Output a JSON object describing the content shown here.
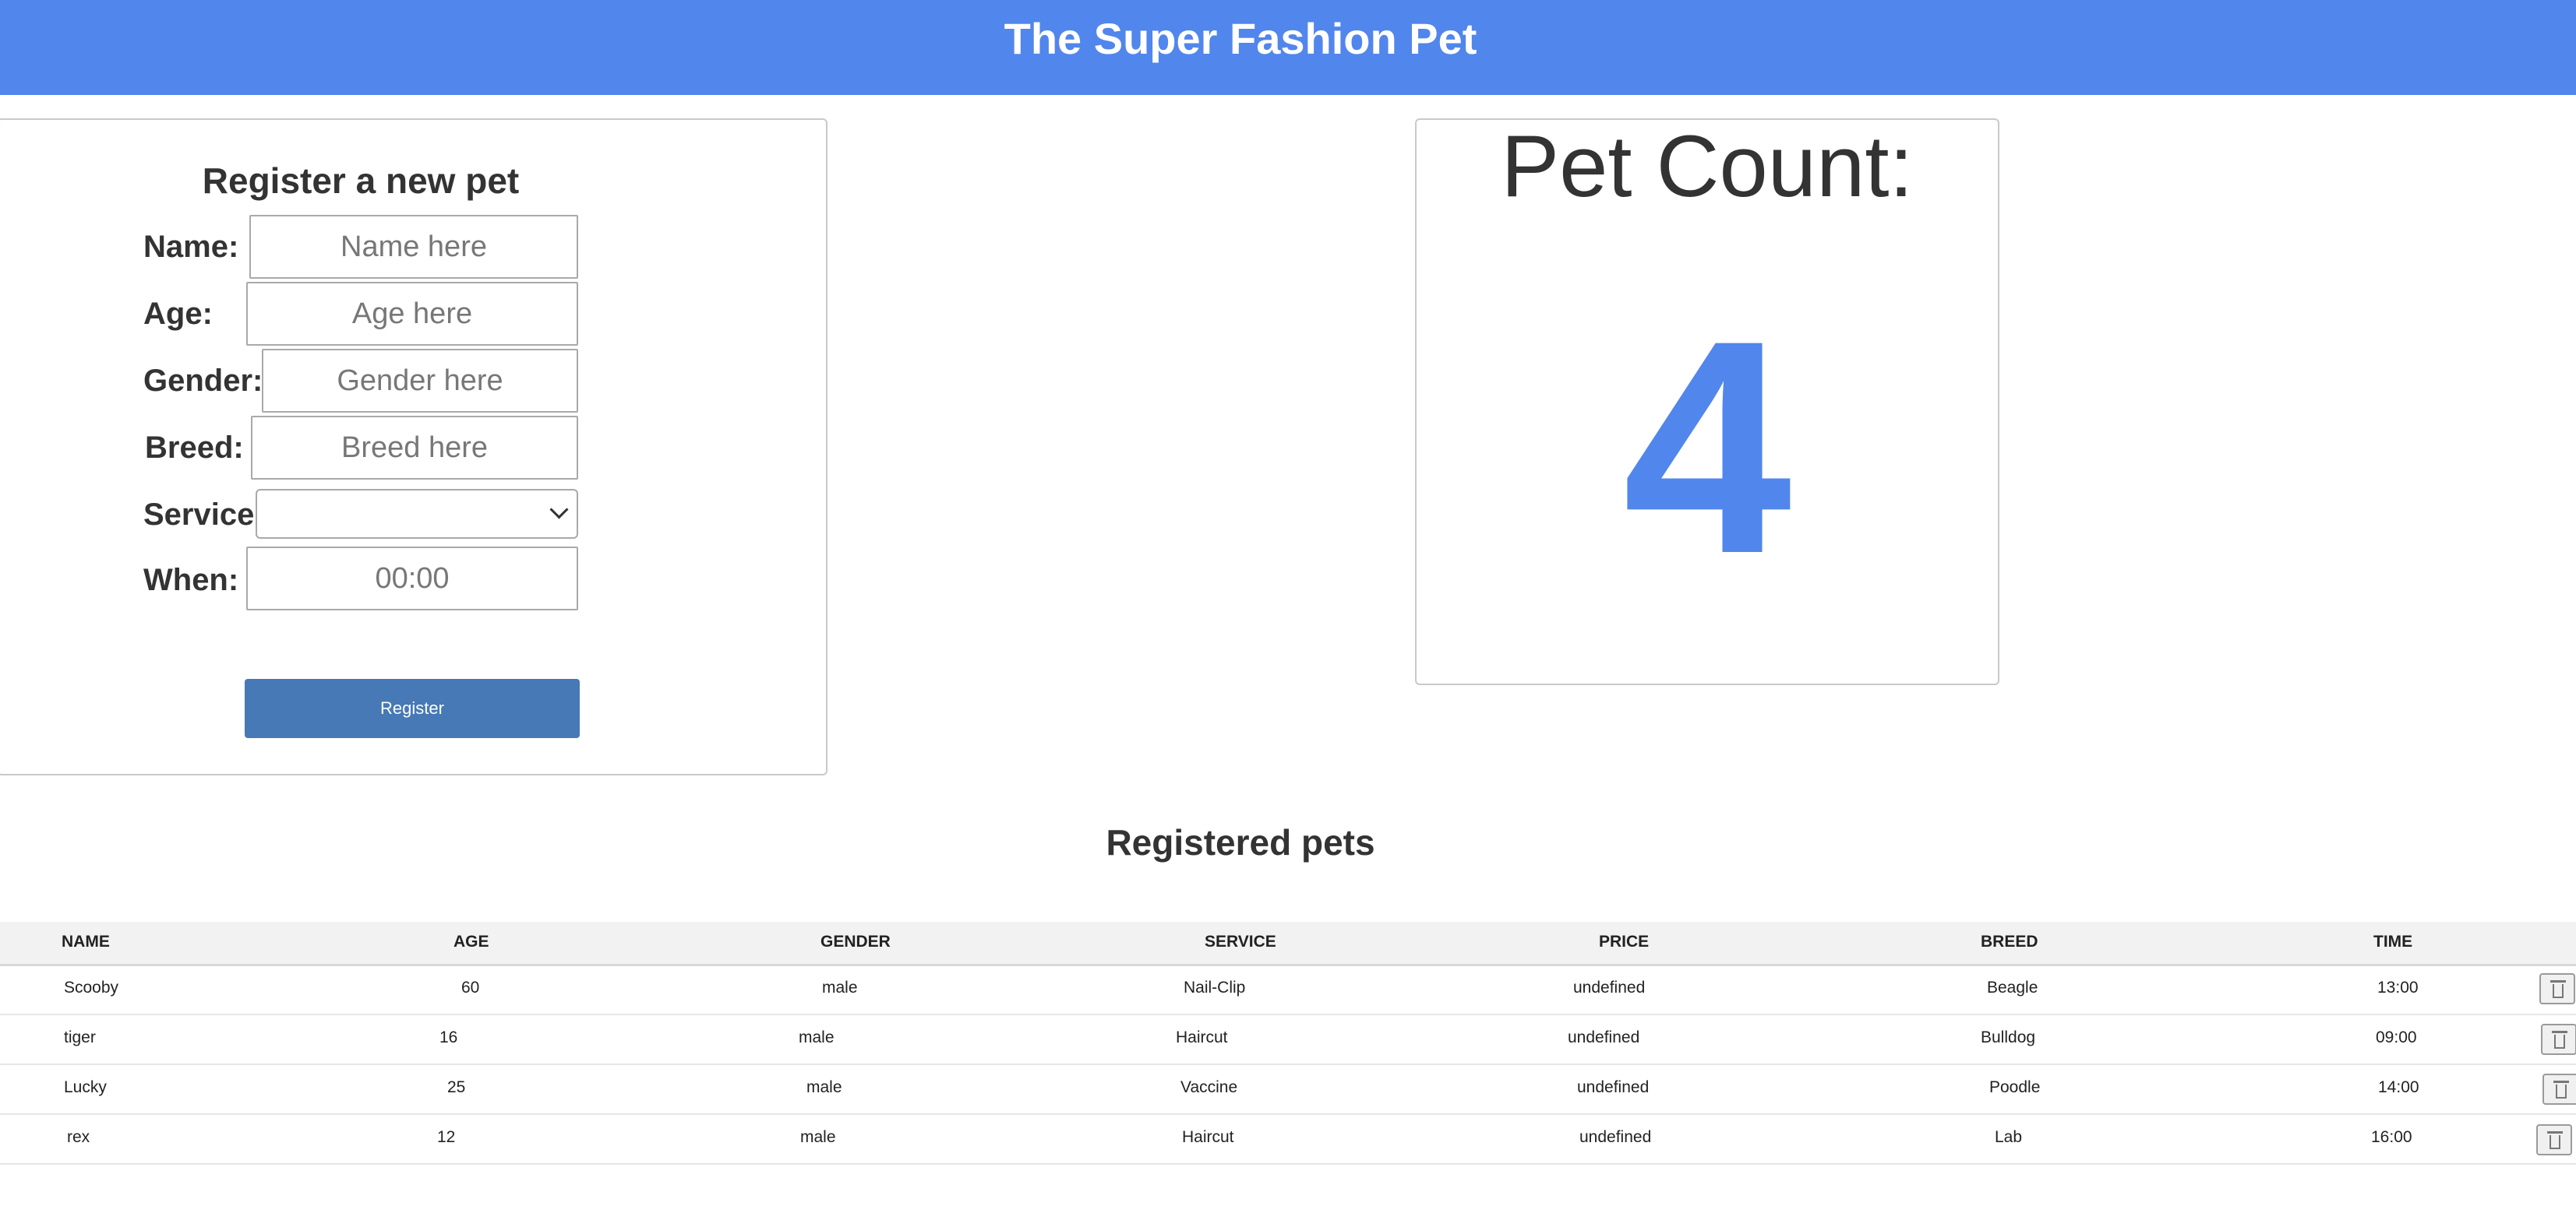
{
  "header": {
    "title": "The Super Fashion Pet"
  },
  "form": {
    "title": "Register a new pet",
    "fields": {
      "name": {
        "label": "Name:",
        "placeholder": "Name here"
      },
      "age": {
        "label": "Age:",
        "placeholder": "Age here"
      },
      "gender": {
        "label": "Gender:",
        "placeholder": "Gender here"
      },
      "breed": {
        "label": "Breed:",
        "placeholder": "Breed here"
      },
      "service": {
        "label": "Service",
        "value": ""
      },
      "when": {
        "label": "When:",
        "placeholder": "00:00"
      }
    },
    "register_label": "Register"
  },
  "counter": {
    "title": "Pet Count:",
    "value": "4"
  },
  "table": {
    "title": "Registered pets",
    "columns": [
      "NAME",
      "AGE",
      "GENDER",
      "SERVICE",
      "PRICE",
      "BREED",
      "TIME"
    ],
    "rows": [
      {
        "name": "Scooby",
        "age": "60",
        "gender": "male",
        "service": "Nail-Clip",
        "price": "undefined",
        "breed": "Beagle",
        "time": "13:00"
      },
      {
        "name": "tiger",
        "age": "16",
        "gender": "male",
        "service": "Haircut",
        "price": "undefined",
        "breed": "Bulldog",
        "time": "09:00"
      },
      {
        "name": "Lucky",
        "age": "25",
        "gender": "male",
        "service": "Vaccine",
        "price": "undefined",
        "breed": "Poodle",
        "time": "14:00"
      },
      {
        "name": "rex",
        "age": "12",
        "gender": "male",
        "service": "Haircut",
        "price": "undefined",
        "breed": "Lab",
        "time": "16:00"
      }
    ]
  },
  "colors": {
    "accent": "#5186ec",
    "button": "#4679b5",
    "table_header": "#f2f2f2"
  },
  "icons": {
    "delete": "trash-icon",
    "select": "chevron-down-icon"
  }
}
